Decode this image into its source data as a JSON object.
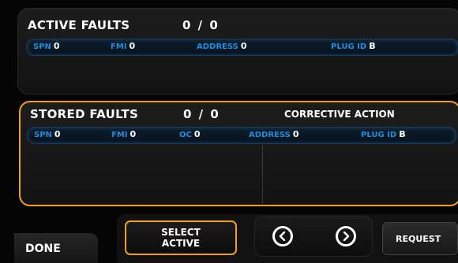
{
  "active_faults": {
    "title": "ACTIVE FAULTS",
    "count": "0 / 0",
    "fields": [
      {
        "label": "SPN",
        "value": "0"
      },
      {
        "label": "FMI",
        "value": "0"
      },
      {
        "label": "ADDRESS",
        "value": "0"
      },
      {
        "label": "PLUG ID",
        "value": "B"
      }
    ]
  },
  "stored_faults": {
    "title": "STORED FAULTS",
    "count": "0 / 0",
    "corrective_action": "CORRECTIVE ACTION",
    "fields": [
      {
        "label": "SPN",
        "value": "0"
      },
      {
        "label": "FMI",
        "value": "0"
      },
      {
        "label": "OC",
        "value": "0"
      },
      {
        "label": "ADDRESS",
        "value": "0"
      },
      {
        "label": "PLUG ID",
        "value": "B"
      }
    ]
  },
  "buttons": {
    "done": "DONE",
    "select_line1": "SELECT",
    "select_line2": "ACTIVE",
    "request": "REQUEST",
    "prev_icon": "chevron-left-icon",
    "next_icon": "chevron-right-icon"
  },
  "colors": {
    "accent": "#f0a020",
    "label_blue": "#1e8de0",
    "background": "#050505"
  }
}
